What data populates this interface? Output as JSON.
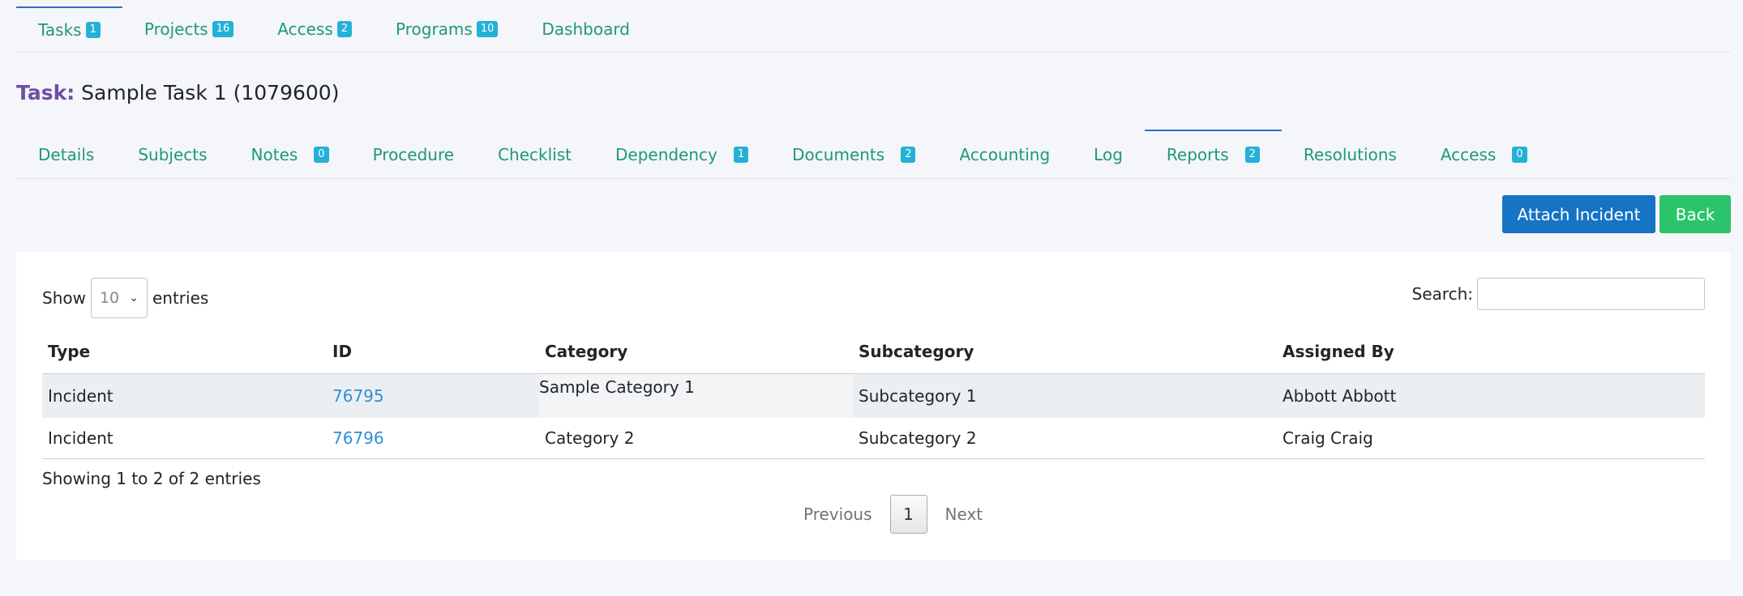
{
  "top_tabs": [
    {
      "label": "Tasks",
      "badge": "1"
    },
    {
      "label": "Projects",
      "badge": "16"
    },
    {
      "label": "Access",
      "badge": "2"
    },
    {
      "label": "Programs",
      "badge": "10"
    },
    {
      "label": "Dashboard",
      "badge": ""
    }
  ],
  "page_title": {
    "label": "Task:",
    "value": "Sample Task 1 (1079600)"
  },
  "sub_tabs": [
    {
      "label": "Details",
      "badge": ""
    },
    {
      "label": "Subjects",
      "badge": ""
    },
    {
      "label": "Notes",
      "badge": "0"
    },
    {
      "label": "Procedure",
      "badge": ""
    },
    {
      "label": "Checklist",
      "badge": ""
    },
    {
      "label": "Dependency",
      "badge": "1"
    },
    {
      "label": "Documents",
      "badge": "2"
    },
    {
      "label": "Accounting",
      "badge": ""
    },
    {
      "label": "Log",
      "badge": ""
    },
    {
      "label": "Reports",
      "badge": "2"
    },
    {
      "label": "Resolutions",
      "badge": ""
    },
    {
      "label": "Access",
      "badge": "0"
    }
  ],
  "buttons": {
    "attach": "Attach Incident",
    "back": "Back"
  },
  "table_controls": {
    "show_label": "Show",
    "entries_value": "10",
    "entries_label": "entries",
    "search_label": "Search:"
  },
  "table": {
    "headers": [
      "Type",
      "ID",
      "Category",
      "Subcategory",
      "Assigned By"
    ],
    "rows": [
      {
        "type": "Incident",
        "id": "76795",
        "category": "Sample Category 1",
        "subcategory": "Subcategory 1",
        "assigned_by": "Abbott Abbott"
      },
      {
        "type": "Incident",
        "id": "76796",
        "category": "Category 2",
        "subcategory": "Subcategory 2",
        "assigned_by": "Craig Craig"
      }
    ]
  },
  "footer": {
    "info": "Showing 1 to 2 of 2 entries",
    "previous": "Previous",
    "page": "1",
    "next": "Next"
  }
}
